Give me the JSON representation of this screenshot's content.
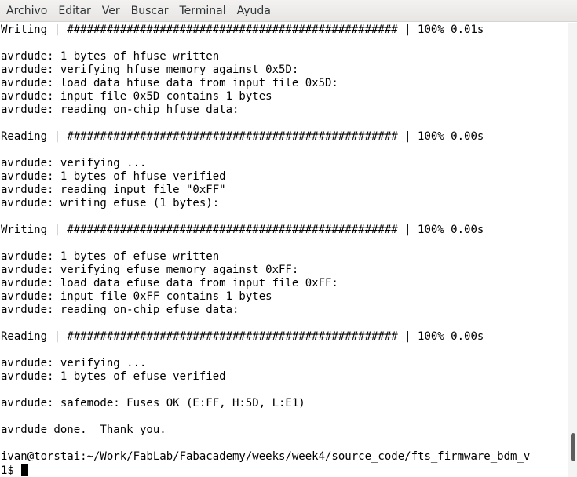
{
  "menubar": {
    "items": [
      "Archivo",
      "Editar",
      "Ver",
      "Buscar",
      "Terminal",
      "Ayuda"
    ]
  },
  "terminal": {
    "lines": [
      "Writing | ################################################## | 100% 0.01s",
      "",
      "avrdude: 1 bytes of hfuse written",
      "avrdude: verifying hfuse memory against 0x5D:",
      "avrdude: load data hfuse data from input file 0x5D:",
      "avrdude: input file 0x5D contains 1 bytes",
      "avrdude: reading on-chip hfuse data:",
      "",
      "Reading | ################################################## | 100% 0.00s",
      "",
      "avrdude: verifying ...",
      "avrdude: 1 bytes of hfuse verified",
      "avrdude: reading input file \"0xFF\"",
      "avrdude: writing efuse (1 bytes):",
      "",
      "Writing | ################################################## | 100% 0.00s",
      "",
      "avrdude: 1 bytes of efuse written",
      "avrdude: verifying efuse memory against 0xFF:",
      "avrdude: load data efuse data from input file 0xFF:",
      "avrdude: input file 0xFF contains 1 bytes",
      "avrdude: reading on-chip efuse data:",
      "",
      "Reading | ################################################## | 100% 0.00s",
      "",
      "avrdude: verifying ...",
      "avrdude: 1 bytes of efuse verified",
      "",
      "avrdude: safemode: Fuses OK (E:FF, H:5D, L:E1)",
      "",
      "avrdude done.  Thank you.",
      "",
      "ivan@torstai:~/Work/FabLab/Fabacademy/weeks/week4/source_code/fts_firmware_bdm_v",
      "1$ "
    ]
  },
  "scrollbar": {
    "position": 0.97
  }
}
